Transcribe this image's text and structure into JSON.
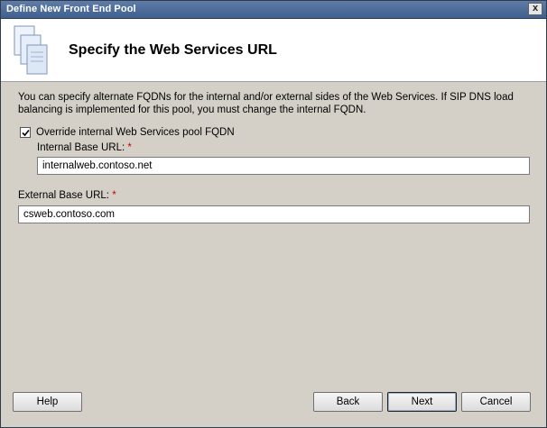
{
  "window": {
    "title": "Define New Front End Pool",
    "close_glyph": "x"
  },
  "header": {
    "title": "Specify the Web Services URL",
    "icon": "server-stack-icon"
  },
  "content": {
    "description_line1": "You can specify alternate FQDNs for the internal and/or external sides of the Web Services.  If SIP DNS load",
    "description_line2": "balancing is implemented for this pool, you must change the internal FQDN.",
    "override": {
      "label": "Override internal Web Services pool FQDN",
      "checked": true
    },
    "internal": {
      "label": "Internal Base URL:",
      "required_mark": "*",
      "value": "internalweb.contoso.net"
    },
    "external": {
      "label": "External Base URL:",
      "required_mark": "*",
      "value": "csweb.contoso.com"
    }
  },
  "buttons": {
    "help": "Help",
    "back": "Back",
    "next": "Next",
    "cancel": "Cancel"
  },
  "colors": {
    "title_bar": "#4a6a99",
    "dialog_bg": "#d4d0c8",
    "required": "#cc0000"
  }
}
